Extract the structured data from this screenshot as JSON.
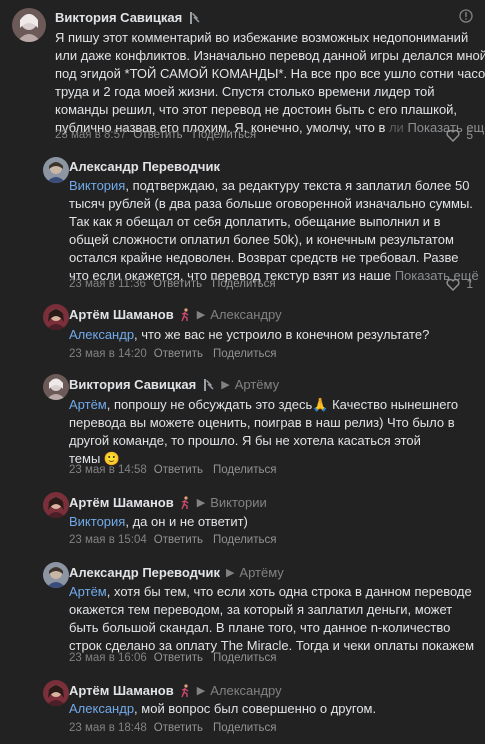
{
  "comments": [
    {
      "author": "Виктория Савицкая",
      "badge_icon": "wizard-staff-icon",
      "lines": [
        "Я пишу этот комментарий во избежание возможных недопониманий",
        "или даже конфликтов. Изначально перевод данной игры делался мной",
        "под эгидой *ТОЙ САМОЙ КОМАНДЫ*. На все про все ушло сотни часов",
        "труда и 2 года моей жизни. Спустя столько времени лидер той",
        "команды решил, что этот перевод не достоин быть с его плашкой,",
        "публично назвав его плохим. Я, конечно, умолчу, что в"
      ],
      "faded_tail": " в ли",
      "show_more": "Показать ещё",
      "date": "23 мая в 8:57",
      "reply_label": "Ответить",
      "share_label": "Поделиться",
      "likes": "5"
    },
    {
      "author": "Александр Переводчик",
      "mention": "Виктория",
      "lines": [
        ", подтверждаю, за редактуру текста я заплатил более 50",
        "тысяч рублей (в два раза больше оговоренной изначально суммы.",
        "Так как я обещал от себя доплатить, обещание выполнил и в",
        "общей сложности оплатил более 50k), и конечным результатом",
        "остался крайне недоволен. Возврат средств не требовал. Разве",
        "что если окажется, что перевод текстур взят из наше"
      ],
      "show_more": "Показать ещё",
      "date": "23 мая в 11:36",
      "reply_label": "Ответить",
      "share_label": "Поделиться",
      "likes": "1"
    },
    {
      "author": "Артём Шаманов",
      "badge_icon": "runner-icon",
      "reply_to": "Александру",
      "mention": "Александр",
      "lines": [
        ", что же вас не устроило в конечном результате?"
      ],
      "date": "23 мая в 14:20",
      "reply_label": "Ответить",
      "share_label": "Поделиться"
    },
    {
      "author": "Виктория Савицкая",
      "badge_icon": "wizard-staff-icon",
      "reply_to": "Артёму",
      "mention": "Артём",
      "lines": [
        ", попрошу не обсуждать это здесь🙏 Качество нынешнего",
        "перевода вы можете оценить, поиграв в наш релиз) Что было в",
        "другой команде, то прошло. Я бы не хотела касаться этой",
        "темы 🙂"
      ],
      "date": "23 мая в 14:58",
      "reply_label": "Ответить",
      "share_label": "Поделиться"
    },
    {
      "author": "Артём Шаманов",
      "badge_icon": "runner-icon",
      "reply_to": "Виктории",
      "mention": "Виктория",
      "lines": [
        ", да он и не ответит)"
      ],
      "date": "23 мая в 15:04",
      "reply_label": "Ответить",
      "share_label": "Поделиться"
    },
    {
      "author": "Александр Переводчик",
      "reply_to": "Артёму",
      "mention": "Артём",
      "lines": [
        ", хотя бы тем, что если хоть одна строка в данном переводе",
        "окажется тем переводом, за который я заплатил деньги, может",
        "быть большой скандал. В плане того, что данное n-количество",
        "строк сделано за оплату The Miracle. Тогда и чеки оплаты покажем"
      ],
      "date": "23 мая в 16:06",
      "reply_label": "Ответить",
      "share_label": "Поделиться"
    },
    {
      "author": "Артём Шаманов",
      "badge_icon": "runner-icon",
      "reply_to": "Александру",
      "mention": "Александр",
      "lines": [
        ", мой вопрос был совершенно о другом."
      ],
      "date": "23 мая в 18:48",
      "reply_label": "Ответить",
      "share_label": "Поделиться"
    }
  ],
  "colors": {
    "background": "#222222",
    "text": "#e1e3e6",
    "mention": "#71aaeb",
    "secondary": "#828282"
  }
}
